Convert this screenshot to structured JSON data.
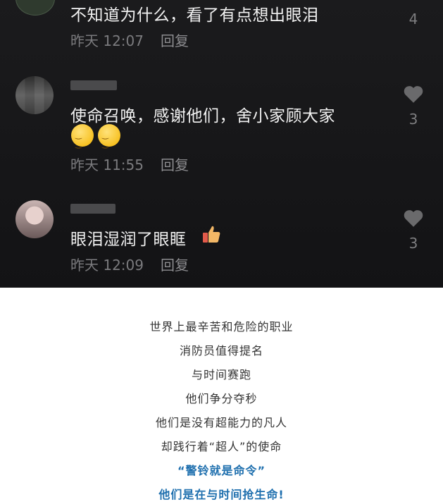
{
  "comments": [
    {
      "text": "不知道为什么，看了有点想出眼泪",
      "time": "昨天 12:07",
      "reply": "回复",
      "likes": "4",
      "avatar_icon": "tiktok-logo-icon"
    },
    {
      "text": "使命召唤，感谢他们，舍小家顾大家",
      "time": "昨天 11:55",
      "reply": "回复",
      "likes": "3",
      "emojis": [
        "smirk-emoji-icon",
        "smirk-emoji-icon"
      ]
    },
    {
      "text": "眼泪湿润了眼眶",
      "time": "昨天 12:09",
      "reply": "回复",
      "likes": "3",
      "emojis": [
        "thumbs-up-emoji-icon"
      ]
    }
  ],
  "article": {
    "lines": [
      "世界上最辛苦和危险的职业",
      "消防员值得提名",
      "与时间赛跑",
      "他们争分夺秒",
      "他们是没有超能力的凡人",
      "却践行着“超人”的使命"
    ],
    "highlight_lines": [
      "“警铃就是命令”",
      "他们是在与时间抢生命!"
    ]
  },
  "colors": {
    "highlight": "#1e6fae",
    "dark_bg": "#161618"
  }
}
